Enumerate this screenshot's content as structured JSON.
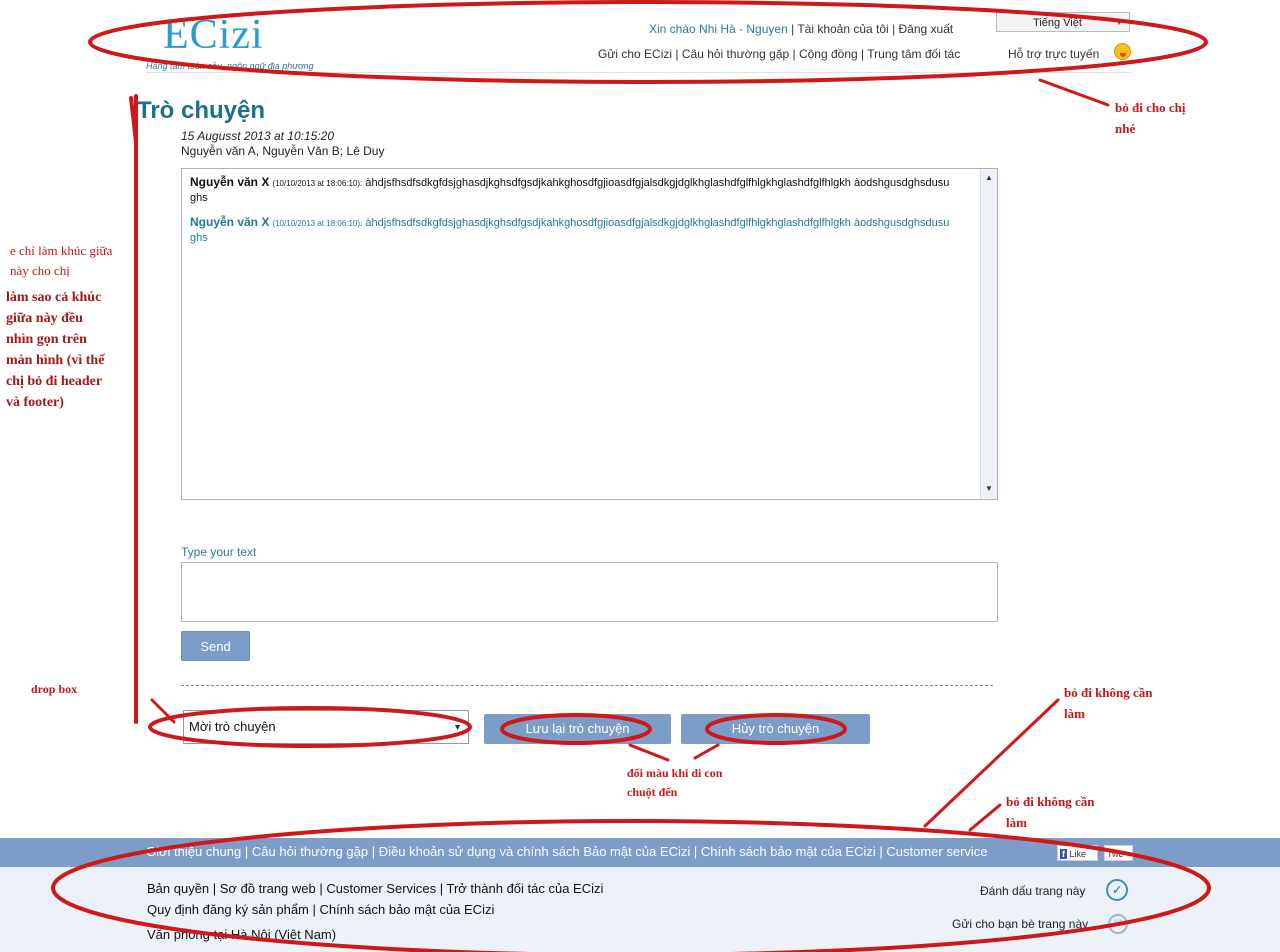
{
  "header": {
    "logo": "ECizi",
    "tagline": "Hàng tầm toàn cầu, ngôn ngữ địa phương",
    "greeting": "Xin chào Nhi Hà - Nguyen",
    "account_link": "Tài khoản của tôi",
    "logout_link": "Đăng xuất",
    "language_select": "Tiếng Việt",
    "nav": [
      "Gửi cho ECizi",
      "Câu hỏi thường gặp",
      "Cộng đồng",
      "Trung tâm đối tác"
    ],
    "support_link": "Hỗ trợ trực tuyến"
  },
  "chat": {
    "title": "Trò chuyện",
    "datetime": "15 Augusst 2013 at 10:15:20",
    "participants": "Nguyễn văn A, Nguyễn Văn B; Lê Duy",
    "messages": [
      {
        "author": "Nguyễn văn X",
        "time": "(10/10/2013 at 18:06:10):",
        "text": "àhdjsfhsdfsdkgfdsjghasdjkghsdfgsdjkahkghosdfgjioasdfgjalsdkgjdglkhglashdfglfhlgkhglashdfglfhlgkh àodshgusdghsdusughs"
      },
      {
        "author": "Nguyễn văn X",
        "time": "(10/10/2013 at 18:06:10):",
        "text": "àhdjsfhsdfsdkgfdsjghasdjkghsdfgsdjkahkghosdfgjioasdfgjalsdkgjdglkhglashdfglfhlgkhglashdfglfhlgkh àodshgusdghsdusughs"
      }
    ],
    "input_label": "Type your text",
    "send_button": "Send",
    "invite_select": "Mời trò chuyện",
    "save_button": "Lưu lại trò chuyện",
    "cancel_button": "Hủy trò chuyện"
  },
  "footer": {
    "links": [
      "Giới thiệu chung",
      "Câu hỏi thường gặp",
      "Điều khoản sử dụng và chính sách Bảo mật của ECizi",
      "Chính sách bảo mật của ECizi",
      "Customer service"
    ],
    "like": "Like",
    "tweet": "Twe",
    "line1": "Bản quyền | Sơ đồ trang web | Customer Services | Trở thành đối tác của ECizi",
    "line2": "Quy định đăng ký sản phẩm | Chính sách bảo mật của ECizi",
    "line3": "Văn phòng tại Hà Nội (Việt Nam)",
    "bookmark": "Đánh dấu trang này",
    "send_friend": "Gửi cho bạn bè trang này"
  },
  "annotations": {
    "remove_header": [
      "bỏ đi cho chị",
      "nhé"
    ],
    "middle_small": [
      "e chỉ làm khúc giữa",
      "này cho chị"
    ],
    "middle_big": [
      "làm sao cả khúc",
      "giữa này đều",
      "nhìn gọn trên",
      "màn hình (vì thế",
      "chị bỏ đi header",
      "và footer)"
    ],
    "drop_box": "drop box",
    "change_color": [
      "đổi màu khi di con",
      "chuột đến"
    ],
    "remove_1": [
      "bỏ đi không cần",
      "làm"
    ],
    "remove_2": [
      "bỏ đi không cần",
      "làm"
    ]
  },
  "colors": {
    "accent": "#7b9dc8",
    "title": "#1e6e8e",
    "annotation": "#c01a1a"
  }
}
